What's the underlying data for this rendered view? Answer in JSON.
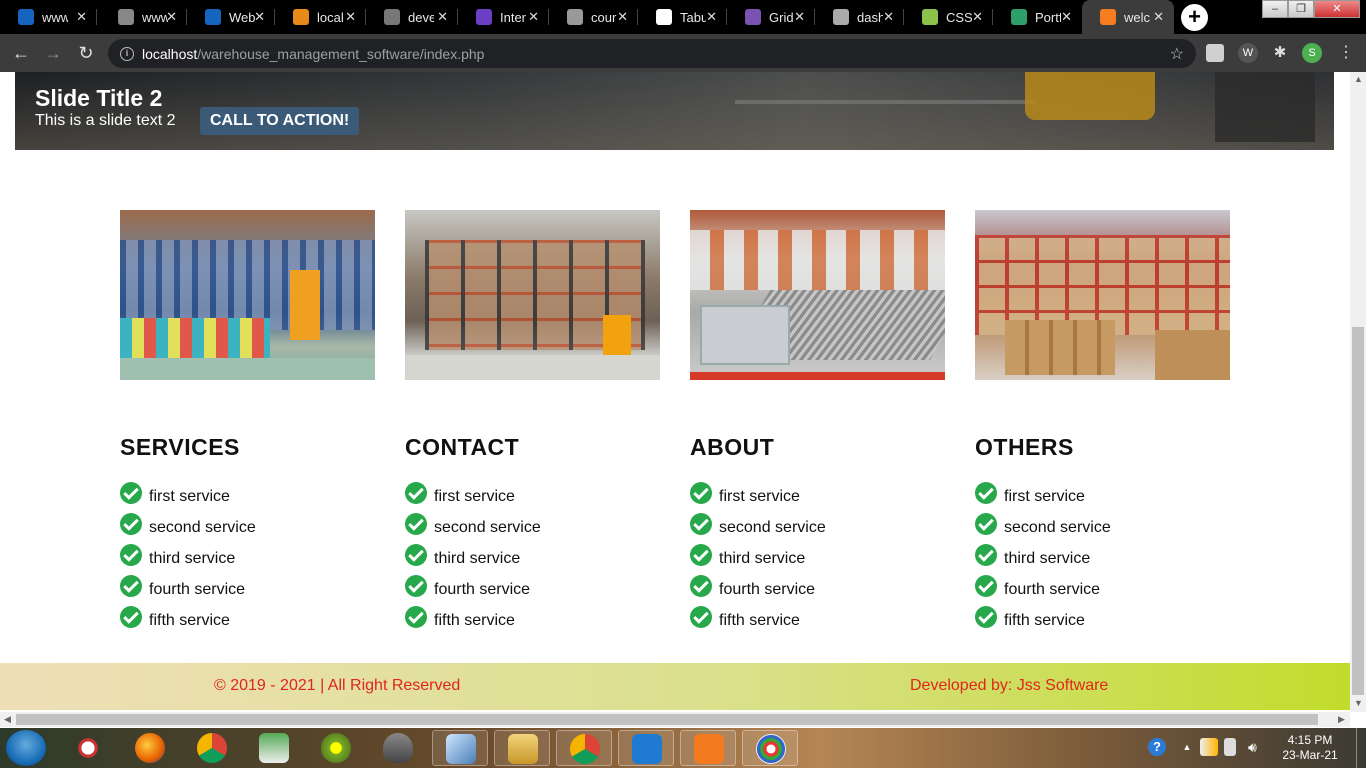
{
  "browser": {
    "tabs": [
      {
        "title": "www",
        "icon_color": "#1565c0"
      },
      {
        "title": "www",
        "icon_color": "#888888"
      },
      {
        "title": "Web",
        "icon_color": "#1565c0"
      },
      {
        "title": "local",
        "icon_color": "#e88a1a"
      },
      {
        "title": "deve",
        "icon_color": "#777777"
      },
      {
        "title": "Inter",
        "icon_color": "#6a3fc3"
      },
      {
        "title": "cour",
        "icon_color": "#999999"
      },
      {
        "title": "Tabu",
        "icon_color": "#ffffff"
      },
      {
        "title": "Grid",
        "icon_color": "#7952b3"
      },
      {
        "title": "dash",
        "icon_color": "#aaaaaa"
      },
      {
        "title": "CSS",
        "icon_color": "#8bc34a"
      },
      {
        "title": "Portf",
        "icon_color": "#2e9e6a"
      },
      {
        "title": "welc",
        "icon_color": "#f57c1f"
      }
    ],
    "url_host": "localhost",
    "url_path": "/warehouse_management_software/index.php",
    "profile_initial": "S"
  },
  "hero": {
    "slide_title": "Slide Title 2",
    "slide_text": "This is a slide text 2",
    "cta_label": "CALL TO ACTION!"
  },
  "columns": [
    {
      "title": "SERVICES",
      "items": [
        "first service",
        "second service",
        "third service",
        "fourth service",
        "fifth service"
      ]
    },
    {
      "title": "CONTACT",
      "items": [
        "first service",
        "second service",
        "third service",
        "fourth service",
        "fifth service"
      ]
    },
    {
      "title": "ABOUT",
      "items": [
        "first service",
        "second service",
        "third service",
        "fourth service",
        "fifth service"
      ]
    },
    {
      "title": "OTHERS",
      "items": [
        "first service",
        "second service",
        "third service",
        "fourth service",
        "fifth service"
      ]
    }
  ],
  "footer": {
    "copyright": "© 2019 - 2021 | All Right Reserved",
    "developer": "Developed by:  Jss Software"
  },
  "colors": {
    "check": "#27a84a",
    "footer_text": "#e0261a",
    "cta_bg": "#3a5a78"
  },
  "taskbar": {
    "time": "4:15 PM",
    "date": "23-Mar-21"
  }
}
